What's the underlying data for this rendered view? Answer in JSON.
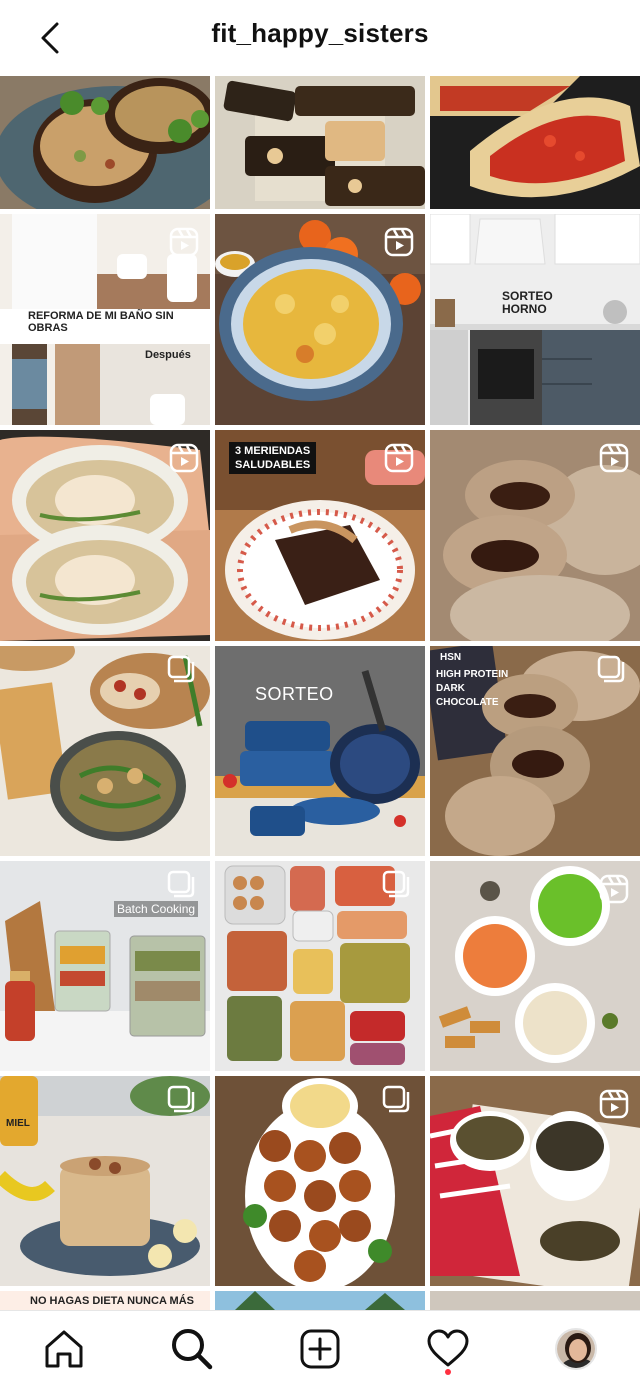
{
  "header": {
    "username": "fit_happy_sisters"
  },
  "grid": {
    "overlays": {
      "bath_title": "REFORMA DE MI BAÑO SIN OBRAS",
      "bath_after": "Después",
      "kitchen_raffle": "SORTEO\nHORNO",
      "snacks": "3 MERIENDAS\nSALUDABLES",
      "cookware_raffle": "SORTEO",
      "chocolate_brand": "HSN",
      "chocolate_label": "HIGH PROTEIN\nDARK\nCHOCOLATE",
      "batch_cooking": "Batch Cooking",
      "honey_label": "MIEL",
      "diet_strip": "NO HAGAS DIETA NUNCA MÁS"
    }
  },
  "colors": {
    "notification_dot": "#ff3040",
    "icon": "#111111"
  },
  "nav": {
    "icons": [
      "home-icon",
      "search-icon",
      "create-post-icon",
      "activity-heart-icon",
      "profile-avatar"
    ]
  }
}
